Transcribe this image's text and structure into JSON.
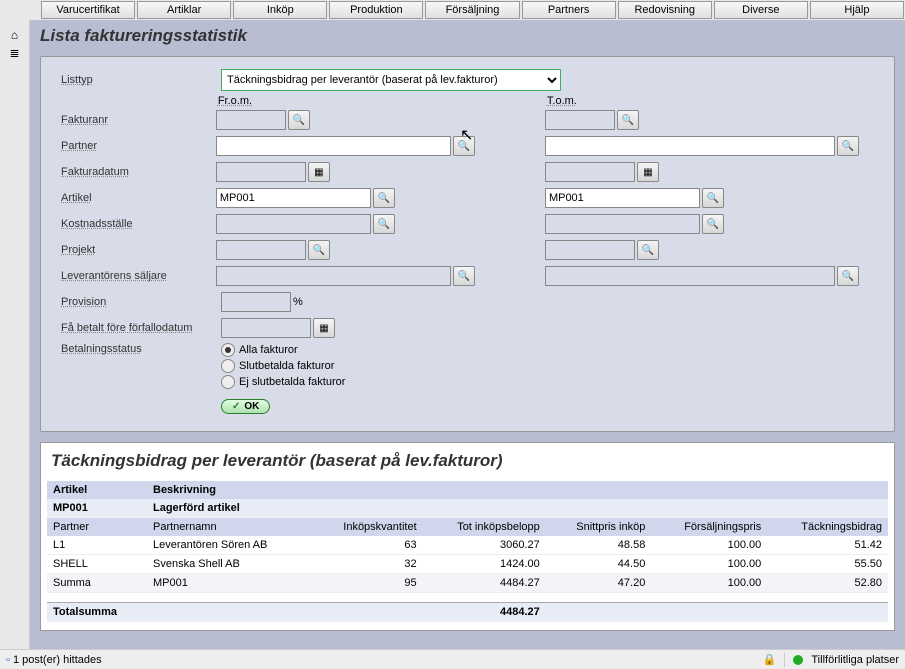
{
  "topnav": [
    "Varucertifikat",
    "Artiklar",
    "Inköp",
    "Produktion",
    "Försäljning",
    "Partners",
    "Redovisning",
    "Diverse",
    "Hjälp"
  ],
  "page_title": "Lista faktureringsstatistik",
  "labels": {
    "listtyp": "Listtyp",
    "from": "Fr.o.m.",
    "to": "T.o.m.",
    "fakturanr": "Fakturanr",
    "partner": "Partner",
    "fakturadatum": "Fakturadatum",
    "artikel": "Artikel",
    "kostnadsstalle": "Kostnadsställe",
    "projekt": "Projekt",
    "lev_saljare": "Leverantörens säljare",
    "provision": "Provision",
    "provision_unit": "%",
    "fa_betalt": "Få betalt före förfallodatum",
    "betalningsstatus": "Betalningsstatus"
  },
  "listtyp_value": "Täckningsbidrag per leverantör (baserat på lev.fakturor)",
  "values": {
    "artikel_from": "MP001",
    "artikel_to": "MP001"
  },
  "radios": {
    "r1": "Alla fakturor",
    "r2": "Slutbetalda fakturor",
    "r3": "Ej slutbetalda fakturor"
  },
  "ok_label": "OK",
  "results_title": "Täckningsbidrag per leverantör (baserat på lev.fakturor)",
  "columns1": {
    "c1": "Artikel",
    "c2": "Beskrivning"
  },
  "article_row": {
    "code": "MP001",
    "desc": "Lagerförd artikel"
  },
  "columns2": {
    "c1": "Partner",
    "c2": "Partnernamn",
    "c3": "Inköpskvantitet",
    "c4": "Tot inköpsbelopp",
    "c5": "Snittpris inköp",
    "c6": "Försäljningspris",
    "c7": "Täckningsbidrag"
  },
  "rows": [
    {
      "partner": "L1",
      "name": "Leverantören Sören AB",
      "qty": "63",
      "total": "3060.27",
      "avg": "48.58",
      "price": "100.00",
      "tb": "51.42"
    },
    {
      "partner": "SHELL",
      "name": "Svenska Shell AB",
      "qty": "32",
      "total": "1424.00",
      "avg": "44.50",
      "price": "100.00",
      "tb": "55.50"
    }
  ],
  "summa": {
    "label": "Summa",
    "name": "MP001",
    "qty": "95",
    "total": "4484.27",
    "avg": "47.20",
    "price": "100.00",
    "tb": "52.80"
  },
  "totalsumma": {
    "label": "Totalsumma",
    "total": "4484.27"
  },
  "status": {
    "left": "1 post(er) hittades",
    "right": "Tillförlitliga platser"
  }
}
